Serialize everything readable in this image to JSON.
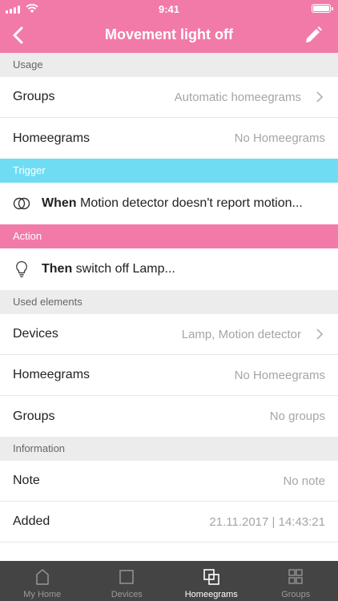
{
  "status_bar": {
    "time": "9:41"
  },
  "nav": {
    "title": "Movement light off"
  },
  "sections": {
    "usage": {
      "header": "Usage",
      "rows": [
        {
          "label": "Groups",
          "value": "Automatic homeegrams"
        },
        {
          "label": "Homeegrams",
          "value": "No Homeegrams"
        }
      ]
    },
    "trigger": {
      "header": "Trigger",
      "keyword": "When",
      "text": " Motion detector doesn't report motion..."
    },
    "action": {
      "header": "Action",
      "keyword": "Then",
      "text": " switch off Lamp..."
    },
    "used_elements": {
      "header": "Used elements",
      "rows": [
        {
          "label": "Devices",
          "value": "Lamp, Motion detector"
        },
        {
          "label": "Homeegrams",
          "value": "No Homeegrams"
        },
        {
          "label": "Groups",
          "value": "No groups"
        }
      ]
    },
    "information": {
      "header": "Information",
      "rows": [
        {
          "label": "Note",
          "value": "No note"
        },
        {
          "label": "Added",
          "value": "21.11.2017 | 14:43:21"
        }
      ]
    }
  },
  "tabs": [
    {
      "label": "My Home",
      "icon": "house-icon",
      "active": false
    },
    {
      "label": "Devices",
      "icon": "square-icon",
      "active": false
    },
    {
      "label": "Homeegrams",
      "icon": "homeegram-icon",
      "active": true
    },
    {
      "label": "Groups",
      "icon": "groups-icon",
      "active": false
    }
  ],
  "colors": {
    "header_pink": "#f27aa8",
    "trigger_blue": "#6fdcf4",
    "tabbar_bg": "#444444"
  }
}
